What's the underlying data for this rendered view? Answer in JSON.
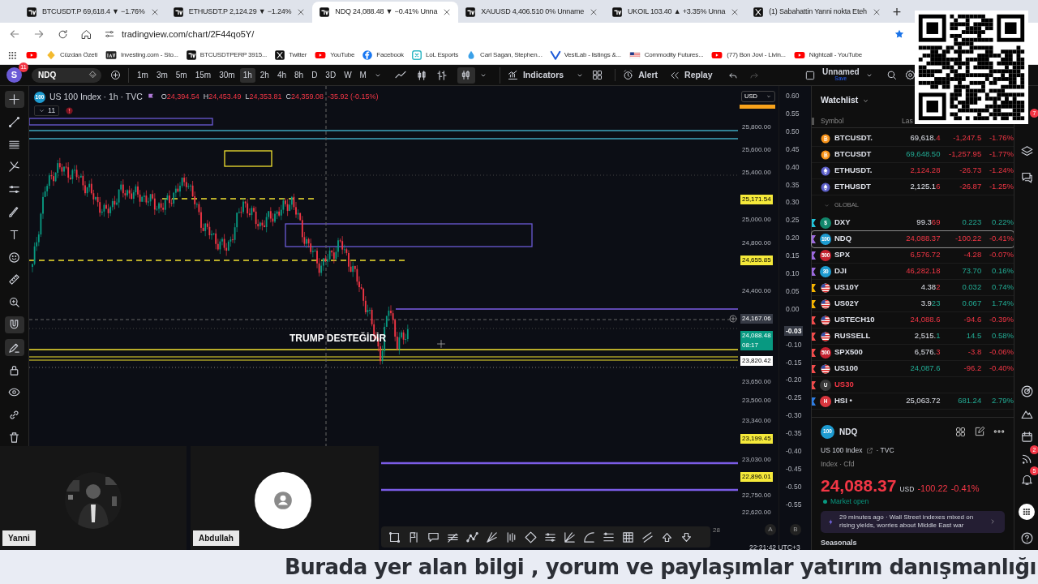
{
  "browser": {
    "tabs": [
      {
        "title": "BTCUSDT.P 69,618.4 ▼ −1.76%",
        "selected": false,
        "kind": "chart"
      },
      {
        "title": "ETHUSDT.P 2,124.29 ▼ −1.24%",
        "selected": false,
        "kind": "chart"
      },
      {
        "title": "NDQ 24,088.48 ▼ −0.41% Unna",
        "selected": true,
        "kind": "chart"
      },
      {
        "title": "XAUUSD 4,406.510 0% Unname",
        "selected": false,
        "kind": "chart"
      },
      {
        "title": "UKOIL 103.40 ▲ +3.35% Unna",
        "selected": false,
        "kind": "chart"
      },
      {
        "title": "(1) Sabahattin Yanni nokta Eteh",
        "selected": false,
        "kind": "x"
      }
    ],
    "new_tab": "+",
    "address": "tradingview.com/chart/2F44qo5Y/",
    "bookmarks": [
      {
        "kind": "video"
      },
      {
        "label": "Cüzdan Özeti",
        "kind": "gem"
      },
      {
        "label": "Investing.com - Sto...",
        "kind": "inv"
      },
      {
        "label": "BTCUSDTPERP 3915...",
        "kind": "chart"
      },
      {
        "label": "Twitter",
        "kind": "x"
      },
      {
        "label": "YouTube",
        "kind": "video"
      },
      {
        "label": "Facebook",
        "kind": "fb"
      },
      {
        "label": "LoL Esports",
        "kind": "lol"
      },
      {
        "label": "Carl Sagan, Stephen...",
        "kind": "drop"
      },
      {
        "label": "VestLab - listings &...",
        "kind": "v"
      },
      {
        "label": "Commodity Futures...",
        "kind": "flag"
      },
      {
        "label": "(77) Bon Jovi - Livin...",
        "kind": "video"
      },
      {
        "label": "Nightcall - YouTube",
        "kind": "video"
      }
    ]
  },
  "toolbar": {
    "avatar": "S",
    "avatar_badge": "11",
    "symbol": "NDQ",
    "intervals": [
      {
        "label": "1m",
        "selected": false
      },
      {
        "label": "3m",
        "selected": false
      },
      {
        "label": "5m",
        "selected": false
      },
      {
        "label": "15m",
        "selected": false
      },
      {
        "label": "30m",
        "selected": false
      },
      {
        "label": "1h",
        "selected": true
      },
      {
        "label": "2h",
        "selected": false
      },
      {
        "label": "4h",
        "selected": false
      },
      {
        "label": "8h",
        "selected": false
      },
      {
        "label": "D",
        "selected": false
      },
      {
        "label": "3D",
        "selected": false
      },
      {
        "label": "W",
        "selected": false
      },
      {
        "label": "M",
        "selected": false
      }
    ],
    "indicators": "Indicators",
    "alert": "Alert",
    "replay": "Replay",
    "layout_name": "Unnamed",
    "save": "Save"
  },
  "chart": {
    "title": "US 100 Index · 1h · TVC",
    "title_badge": "100",
    "ohlc": [
      {
        "key": "O",
        "value": "24,394.54"
      },
      {
        "key": "H",
        "value": "24,453.49"
      },
      {
        "key": "L",
        "value": "24,353.81"
      },
      {
        "key": "C",
        "value": "24,359.08"
      }
    ],
    "change": "-35.92 (-0.15%)",
    "collapse_count": "11",
    "currency": "USD",
    "note": "TRUMP DESTEĞİDİR",
    "price_axis": [
      {
        "text": "25,800.00",
        "kind": "tick"
      },
      {
        "text": "25,600.00",
        "kind": "tick"
      },
      {
        "text": "25,400.00",
        "kind": "tick"
      },
      {
        "text": "25,171.54",
        "kind": "marker"
      },
      {
        "text": "25,000.00",
        "kind": "tick"
      },
      {
        "text": "24,800.00",
        "kind": "tick"
      },
      {
        "text": "24,655.85",
        "kind": "marker"
      },
      {
        "text": "24,400.00",
        "kind": "tick"
      },
      {
        "text": "24,167.06",
        "kind": "crosshair"
      },
      {
        "text": "24,088.48",
        "kind": "last",
        "sub": "08:17"
      },
      {
        "text": "23,820.42",
        "kind": "line"
      },
      {
        "text": "23,650.00",
        "kind": "tick"
      },
      {
        "text": "23,500.00",
        "kind": "tick"
      },
      {
        "text": "23,340.00",
        "kind": "tick"
      },
      {
        "text": "23,199.45",
        "kind": "marker"
      },
      {
        "text": "23,030.00",
        "kind": "tick"
      },
      {
        "text": "22,896.01",
        "kind": "marker"
      },
      {
        "text": "22,750.00",
        "kind": "tick"
      },
      {
        "text": "22,620.00",
        "kind": "tick"
      }
    ],
    "percent_axis": [
      {
        "text": "0.60",
        "kind": "tick"
      },
      {
        "text": "0.55",
        "kind": "tick"
      },
      {
        "text": "0.50",
        "kind": "tick"
      },
      {
        "text": "0.45",
        "kind": "tick"
      },
      {
        "text": "0.40",
        "kind": "tick"
      },
      {
        "text": "0.35",
        "kind": "tick"
      },
      {
        "text": "0.30",
        "kind": "tick"
      },
      {
        "text": "0.25",
        "kind": "tick"
      },
      {
        "text": "0.20",
        "kind": "tick"
      },
      {
        "text": "0.15",
        "kind": "tick"
      },
      {
        "text": "0.10",
        "kind": "tick"
      },
      {
        "text": "0.05",
        "kind": "tick"
      },
      {
        "text": "0.00",
        "kind": "tick"
      },
      {
        "text": "-0.03",
        "kind": "crosshair"
      },
      {
        "text": "-0.10",
        "kind": "tick"
      },
      {
        "text": "-0.15",
        "kind": "tick"
      },
      {
        "text": "-0.20",
        "kind": "tick"
      },
      {
        "text": "-0.25",
        "kind": "tick"
      },
      {
        "text": "-0.30",
        "kind": "tick"
      },
      {
        "text": "-0.35",
        "kind": "tick"
      },
      {
        "text": "-0.40",
        "kind": "tick"
      },
      {
        "text": "-0.45",
        "kind": "tick"
      },
      {
        "text": "-0.50",
        "kind": "tick"
      },
      {
        "text": "-0.55",
        "kind": "tick"
      }
    ],
    "axis_buttons": [
      "A",
      "B"
    ],
    "date_tick": "28",
    "clock": "22:21:42 UTC+3"
  },
  "watchlist": {
    "title": "Watchlist",
    "columns": [
      "Symbol",
      "Las"
    ],
    "rows": [
      {
        "kind": "symbol",
        "symbol": "BTCUSDT.",
        "icon": {
          "kind": "coin",
          "color": "#f7931a"
        },
        "last": {
          "text": "69,618.",
          "highlight": false
        },
        "last_tail": {
          "text": "4",
          "up": false
        },
        "change": {
          "text": "-1,247.5",
          "up": false
        },
        "percent": {
          "text": "-1.76%",
          "up": false
        },
        "invalid": false,
        "selected": false
      },
      {
        "kind": "symbol",
        "symbol": "BTCUSDT",
        "icon": {
          "kind": "coin",
          "color": "#f7931a"
        },
        "last": {
          "text": "69,648.50",
          "highlight": true,
          "up": true
        },
        "change": {
          "text": "-1,257.95",
          "up": false
        },
        "percent": {
          "text": "-1.77%",
          "up": false
        },
        "invalid": false,
        "selected": false
      },
      {
        "kind": "symbol",
        "symbol": "ETHUSDT.",
        "icon": {
          "kind": "eth",
          "color": "#5c5fc8"
        },
        "last": {
          "text": "2,124.28",
          "highlight": true,
          "up": false
        },
        "change": {
          "text": "-26.73",
          "up": false
        },
        "percent": {
          "text": "-1.24%",
          "up": false
        },
        "invalid": false,
        "selected": false
      },
      {
        "kind": "symbol",
        "symbol": "ETHUSDT",
        "icon": {
          "kind": "eth",
          "color": "#5c5fc8"
        },
        "last": {
          "text": "2,125.1",
          "highlight": false
        },
        "last_tail": {
          "text": "6",
          "up": false
        },
        "change": {
          "text": "-26.87",
          "up": false
        },
        "percent": {
          "text": "-1.25%",
          "up": false
        },
        "invalid": false,
        "selected": false
      },
      {
        "kind": "group",
        "label": "GLOBAL"
      },
      {
        "kind": "symbol",
        "symbol": "DXY",
        "icon": {
          "kind": "badge",
          "badge": "$",
          "color": "#12876c"
        },
        "flag": {
          "color": "#22c3d8"
        },
        "last": {
          "text": "99.3",
          "highlight": false
        },
        "last_tail": {
          "text": "69",
          "up": false
        },
        "change": {
          "text": "0.223",
          "up": true
        },
        "percent": {
          "text": "0.22%",
          "up": true
        },
        "invalid": false,
        "selected": false
      },
      {
        "kind": "symbol",
        "symbol": "NDQ",
        "icon": {
          "kind": "badge",
          "badge": "100",
          "color": "#1e9bd0"
        },
        "flag": {
          "color": "#9c6ade"
        },
        "last": {
          "text": "24,088.37",
          "highlight": true,
          "up": false
        },
        "change": {
          "text": "-100.22",
          "up": false
        },
        "percent": {
          "text": "-0.41%",
          "up": false
        },
        "invalid": false,
        "selected": true
      },
      {
        "kind": "symbol",
        "symbol": "SPX",
        "icon": {
          "kind": "badge",
          "badge": "500",
          "color": "#c4212f"
        },
        "flag": {
          "color": "#9c6ade"
        },
        "last": {
          "text": "6,576.72",
          "highlight": true,
          "up": false
        },
        "change": {
          "text": "-4.28",
          "up": false
        },
        "percent": {
          "text": "-0.07%",
          "up": false
        },
        "invalid": false,
        "selected": false
      },
      {
        "kind": "symbol",
        "symbol": "DJI",
        "icon": {
          "kind": "badge",
          "badge": "30",
          "color": "#1e9bd0"
        },
        "flag": {
          "color": "#9c6ade"
        },
        "last": {
          "text": "46,282.18",
          "highlight": true,
          "up": false
        },
        "change": {
          "text": "73.70",
          "up": true
        },
        "percent": {
          "text": "0.16%",
          "up": true
        },
        "invalid": false,
        "selected": false
      },
      {
        "kind": "symbol",
        "symbol": "US10Y",
        "icon": {
          "kind": "us"
        },
        "flag": {
          "color": "#f5b400"
        },
        "last": {
          "text": "4.38",
          "highlight": false
        },
        "last_tail": {
          "text": "2",
          "up": false
        },
        "change": {
          "text": "0.032",
          "up": true
        },
        "percent": {
          "text": "0.74%",
          "up": true
        },
        "invalid": false,
        "selected": false
      },
      {
        "kind": "symbol",
        "symbol": "US02Y",
        "icon": {
          "kind": "us"
        },
        "flag": {
          "color": "#f5b400"
        },
        "last": {
          "text": "3.9",
          "highlight": false
        },
        "last_tail": {
          "text": "23",
          "up": true
        },
        "change": {
          "text": "0.067",
          "up": true
        },
        "percent": {
          "text": "1.74%",
          "up": true
        },
        "invalid": false,
        "selected": false
      },
      {
        "kind": "symbol",
        "symbol": "USTECH10",
        "icon": {
          "kind": "us"
        },
        "flag": {
          "color": "#f24c4c"
        },
        "last": {
          "text": "24,088.6",
          "highlight": true,
          "up": false
        },
        "change": {
          "text": "-94.6",
          "up": false
        },
        "percent": {
          "text": "-0.39%",
          "up": false
        },
        "invalid": false,
        "selected": false
      },
      {
        "kind": "symbol",
        "symbol": "RUSSELL",
        "icon": {
          "kind": "us"
        },
        "flag": {
          "color": "#f24c4c"
        },
        "last": {
          "text": "2,515.",
          "highlight": false
        },
        "last_tail": {
          "text": "1",
          "up": true
        },
        "change": {
          "text": "14.5",
          "up": true
        },
        "percent": {
          "text": "0.58%",
          "up": true
        },
        "invalid": false,
        "selected": false
      },
      {
        "kind": "symbol",
        "symbol": "SPX500",
        "icon": {
          "kind": "badge",
          "badge": "500",
          "color": "#c4212f"
        },
        "flag": {
          "color": "#f24c4c"
        },
        "last": {
          "text": "6,576.",
          "highlight": false
        },
        "last_tail": {
          "text": "3",
          "up": false
        },
        "change": {
          "text": "-3.8",
          "up": false
        },
        "percent": {
          "text": "-0.06%",
          "up": false
        },
        "invalid": false,
        "selected": false
      },
      {
        "kind": "symbol",
        "symbol": "US100",
        "icon": {
          "kind": "us"
        },
        "flag": {
          "color": "#f24c4c"
        },
        "last": {
          "text": "24,087.6",
          "highlight": true,
          "up": true
        },
        "change": {
          "text": "-96.2",
          "up": false
        },
        "percent": {
          "text": "-0.40%",
          "up": false
        },
        "invalid": false,
        "selected": false
      },
      {
        "kind": "symbol",
        "symbol": "US30",
        "icon": {
          "kind": "badge",
          "badge": "U",
          "color": "#3a3a3a"
        },
        "flag": {
          "color": "#f24c4c"
        },
        "invalid": true,
        "selected": false
      },
      {
        "kind": "symbol",
        "symbol": "HSI •",
        "icon": {
          "kind": "badge",
          "badge": "H",
          "color": "#d9363e"
        },
        "flag": {
          "color": "#2f7de1"
        },
        "last": {
          "text": "25,063.72",
          "highlight": false
        },
        "change": {
          "text": "681.24",
          "up": true
        },
        "percent": {
          "text": "2.79%",
          "up": true
        },
        "invalid": false,
        "selected": false
      }
    ]
  },
  "details": {
    "badge": "100",
    "symbol": "NDQ",
    "name": "US 100 Index",
    "separator": "·",
    "source": "TVC",
    "category": "Index · Cfd",
    "price": "24,088.37",
    "currency": "USD",
    "change": "-100.22",
    "percent": "-0.41%",
    "market": "Market open",
    "news_time": "29 minutes ago",
    "news": "Wall Street indexes mixed on rising yields, worries about Middle East war",
    "next_section": "Seasonals"
  },
  "right_bar": [
    {
      "kind": "covered",
      "badge": "7"
    },
    {
      "kind": "layers"
    },
    {
      "kind": "chat"
    },
    {
      "kind": "target"
    },
    {
      "kind": "mountain"
    },
    {
      "kind": "calendar"
    },
    {
      "kind": "feed",
      "badge": "2"
    },
    {
      "kind": "bell",
      "badge": "5"
    },
    {
      "kind": "apps"
    },
    {
      "kind": "help"
    }
  ],
  "participants": [
    {
      "name": "Yanni"
    },
    {
      "name": "Abdullah",
      "kind": "placeholder"
    }
  ],
  "banner": "Burada yer alan bilgi , yorum ve paylaşımlar yatırım danışmanlığı"
}
